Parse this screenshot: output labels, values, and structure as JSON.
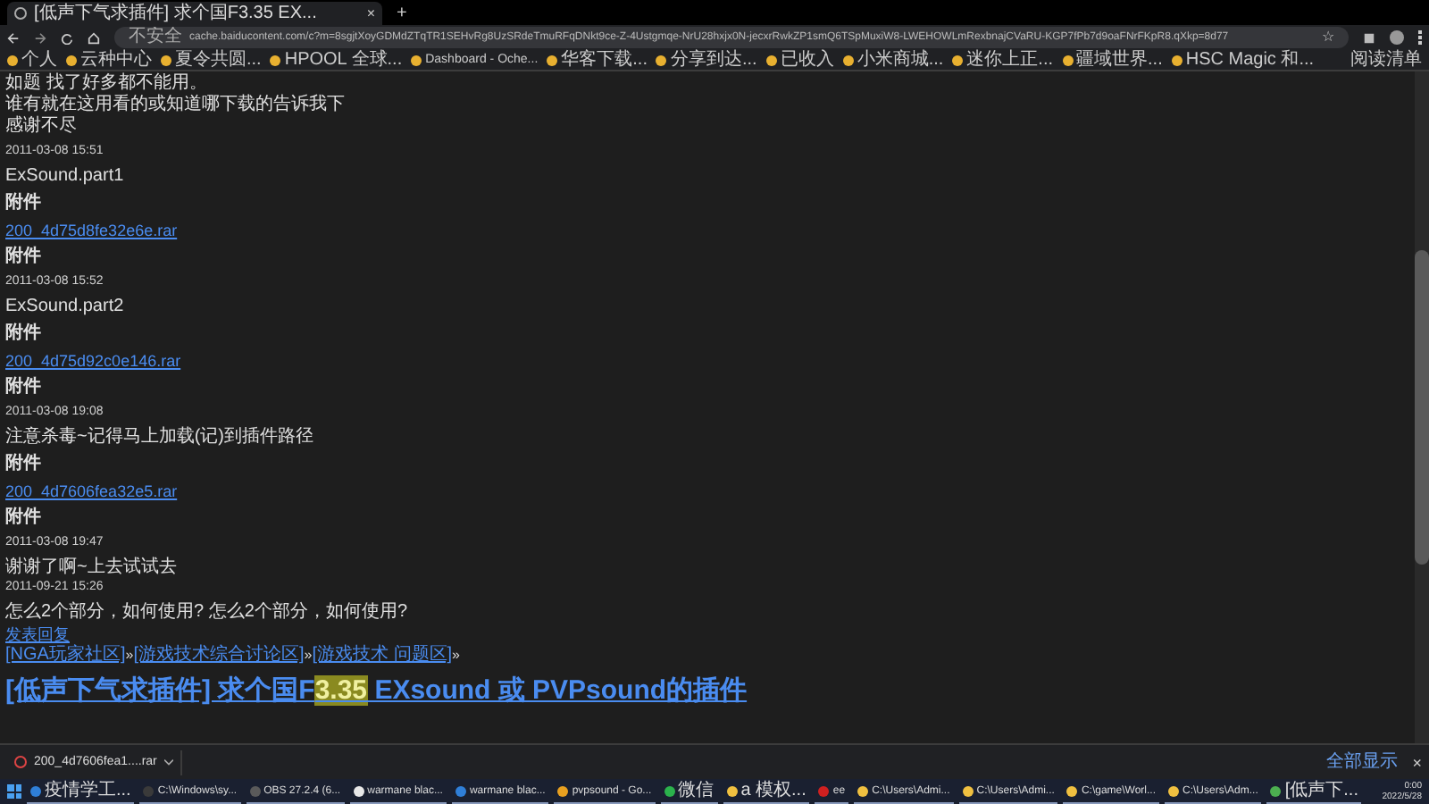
{
  "tab": {
    "title": "[低声下气求插件] 求个国F3.35 EX...",
    "close": "×",
    "new_tab": "+"
  },
  "address_bar": {
    "security": "不安全",
    "url": "cache.baiducontent.com/c?m=8sgjtXoyGDMdZTqTR1SEHvRg8UzSRdeTmuRFqDNkt9ce-Z-4Ustgmqe-NrU28hxjx0N-jecxrRwkZP1smQ6TSpMuxiW8-LWEHOWLmRexbnajCVaRU-KGP7fPb7d9oaFNrFKpR8.qXkp=8d77",
    "bookmark": "☆"
  },
  "bookmarks": [
    "个人",
    "云种中心",
    "夏令共圆...",
    "HPOOL 全球...",
    "Dashboard - Oche...",
    "华客下载...",
    "分享到达...",
    "已收入",
    "小米商城...",
    "迷你上正...",
    "疆域世界...",
    "HSC Magic 和..."
  ],
  "reading_list": "阅读清单",
  "page": {
    "groups": [
      [
        {
          "kind": "text",
          "text": "如题 找了好多都不能用。"
        },
        {
          "kind": "text",
          "text": "谁有就在这用看的或知道哪下载的告诉我下"
        },
        {
          "kind": "text",
          "text": "感谢不尽"
        }
      ],
      [
        {
          "kind": "date",
          "text": "2011-03-08 15:51"
        }
      ],
      [
        {
          "kind": "text",
          "text": "ExSound.part1"
        }
      ],
      [
        {
          "kind": "label",
          "text": "附件"
        }
      ],
      [
        {
          "kind": "link",
          "text": "200_4d75d8fe32e6e.rar"
        }
      ],
      [
        {
          "kind": "label",
          "text": "附件"
        }
      ],
      [
        {
          "kind": "date",
          "text": "2011-03-08 15:52"
        }
      ],
      [
        {
          "kind": "text",
          "text": "ExSound.part2"
        }
      ],
      [
        {
          "kind": "label",
          "text": "附件"
        }
      ],
      [
        {
          "kind": "link",
          "text": "200_4d75d92c0e146.rar"
        }
      ],
      [
        {
          "kind": "label",
          "text": "附件"
        }
      ],
      [
        {
          "kind": "date",
          "text": "2011-03-08 19:08"
        }
      ],
      [
        {
          "kind": "text",
          "text": "注意杀毒~记得马上加载(记)到插件路径"
        }
      ],
      [
        {
          "kind": "label",
          "text": "附件"
        }
      ],
      [
        {
          "kind": "link",
          "text": "200_4d7606fea32e5.rar"
        }
      ],
      [
        {
          "kind": "label",
          "text": "附件"
        }
      ],
      [
        {
          "kind": "date",
          "text": "2011-03-08 19:47"
        }
      ],
      [
        {
          "kind": "text",
          "text": "谢谢了啊~上去试试去"
        },
        {
          "kind": "date",
          "text": "2011-09-21 15:26"
        }
      ],
      [
        {
          "kind": "text",
          "text": "怎么2个部分，如何使用? 怎么2个部分，如何使用?"
        },
        {
          "kind": "link",
          "text": "发表回复"
        }
      ]
    ],
    "breadcrumb": [
      {
        "text": "[NGA玩家社区]",
        "sep": "»"
      },
      {
        "text": "[游戏技术综合讨论区]",
        "sep": "»"
      },
      {
        "text": "[游戏技术 问题区]",
        "sep": "»"
      }
    ],
    "title": {
      "before": "[低声下气求插件] 求个国F",
      "highlight": "3.35",
      "after": " EXsound 或 PVPsound的插件"
    }
  },
  "download_bar": {
    "file": "200_4d7606fea1....rar",
    "show_all": "全部显示",
    "close": "×"
  },
  "taskbar": {
    "items": [
      {
        "label": "疫情学工...",
        "color": "#2f7fd8"
      },
      {
        "label": "C:\\Windows\\sy...",
        "color": "#3a3a3a"
      },
      {
        "label": "OBS 27.2.4 (6...",
        "color": "#5a5a5a"
      },
      {
        "label": "warmane blac...",
        "color": "#e8e8e8"
      },
      {
        "label": "warmane blac...",
        "color": "#2f7fd8"
      },
      {
        "label": "pvpsound - Go...",
        "color": "#e8a020"
      },
      {
        "label": "微信",
        "color": "#2bb24c"
      },
      {
        "label": "a 模权...",
        "color": "#f0c040"
      },
      {
        "label": "ee",
        "color": "#d02020"
      },
      {
        "label": "C:\\Users\\Admi...",
        "color": "#f0c040"
      },
      {
        "label": "C:\\Users\\Admi...",
        "color": "#f0c040"
      },
      {
        "label": "C:\\game\\Worl...",
        "color": "#f0c040"
      },
      {
        "label": "C:\\Users\\Adm...",
        "color": "#f0c040"
      },
      {
        "label": "[低声下...",
        "color": "#4caf50"
      }
    ],
    "time": "0:00",
    "date": "2022/5/28"
  }
}
